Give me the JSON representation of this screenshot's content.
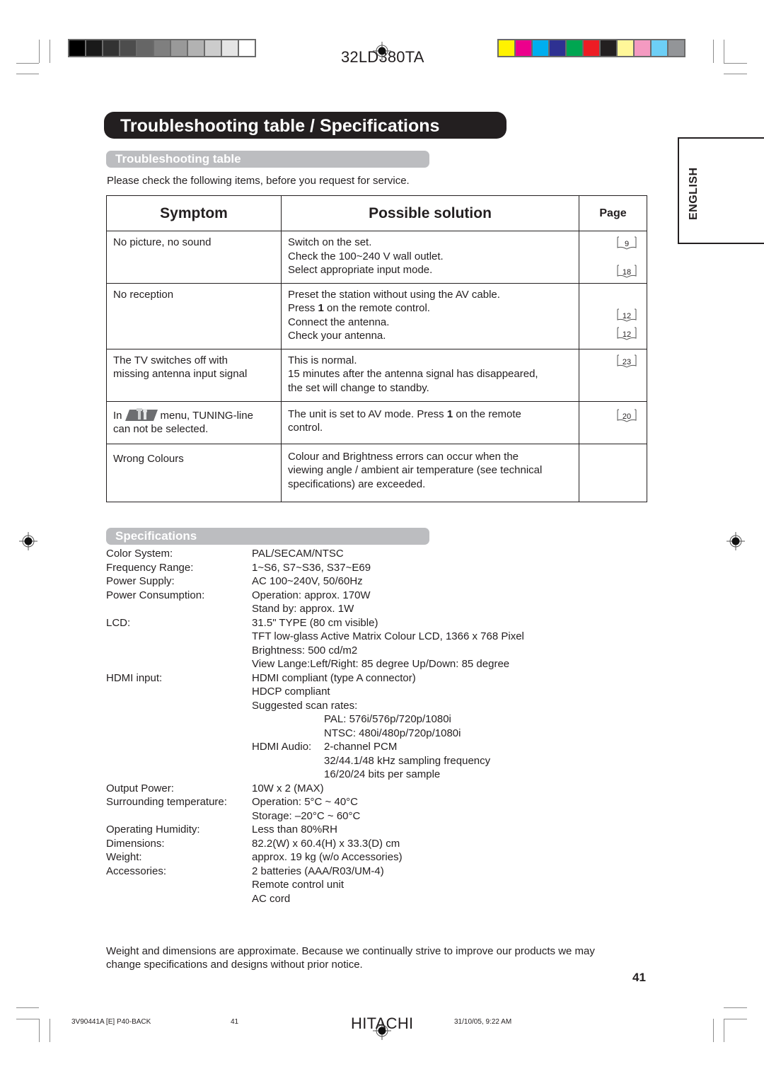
{
  "header": {
    "model": "32LD380TA",
    "grayscale_swatches": [
      "#000000",
      "#1a1a1a",
      "#333333",
      "#4d4d4d",
      "#666666",
      "#7f7f7f",
      "#999999",
      "#b2b2b2",
      "#cccccc",
      "#e5e5e5",
      "#ffffff"
    ],
    "color_swatches": [
      "#fff200",
      "#ec008c",
      "#00aeef",
      "#2e3192",
      "#00a651",
      "#ed1c24",
      "#231f20",
      "#fff799",
      "#f49ac1",
      "#6dcff6",
      "#939598"
    ]
  },
  "title": "Troubleshooting table / Specifications",
  "language_tab": "ENGLISH",
  "troubleshooting": {
    "heading": "Troubleshooting table",
    "intro": "Please check the following items, before you request for service.",
    "columns": {
      "symptom": "Symptom",
      "solution": "Possible solution",
      "page": "Page"
    },
    "rows": [
      {
        "symptom": "No picture, no sound",
        "solution": [
          "Switch on the set.",
          "Check the 100~240 V wall outlet.",
          "Select appropriate input mode."
        ],
        "pages": [
          "9",
          "18"
        ]
      },
      {
        "symptom": "No reception",
        "solution": [
          "Preset the station without using the AV cable.",
          "Press ",
          "1",
          " on the remote control.",
          "Connect the antenna.",
          "Check your antenna."
        ],
        "pages": [
          "12",
          "12"
        ]
      },
      {
        "symptom_lines": [
          "The TV switches off with",
          "missing antenna input signal"
        ],
        "solution": [
          "This is normal.",
          "15 minutes after the antenna signal has disappeared,",
          "the set will change to standby."
        ],
        "pages": [
          "23"
        ]
      },
      {
        "symptom_prefix": "In",
        "symptom_icon": "setup-menu-icon",
        "symptom_suffix": "menu, TUNING-line",
        "symptom_line2": "can not be selected.",
        "solution_a": "The unit is set to AV mode. Press ",
        "solution_bold": "1",
        "solution_b": " on the remote",
        "solution_line2": "control.",
        "pages": [
          "20"
        ]
      },
      {
        "symptom": "Wrong Colours",
        "solution": [
          "Colour and Brightness errors can occur when the",
          "viewing angle / ambient air temperature (see technical",
          "specifications) are exceeded."
        ]
      }
    ]
  },
  "specifications": {
    "heading": "Specifications",
    "items": [
      {
        "label": "Color System:",
        "values": [
          "PAL/SECAM/NTSC"
        ]
      },
      {
        "label": "Frequency Range:",
        "values": [
          "1~S6, S7~S36, S37~E69"
        ]
      },
      {
        "label": "Power Supply:",
        "values": [
          "AC 100~240V, 50/60Hz"
        ]
      },
      {
        "label": "Power Consumption:",
        "values": [
          "Operation: approx. 170W",
          "Stand by:  approx. 1W"
        ]
      },
      {
        "label": "LCD:",
        "values": [
          "31.5\" TYPE (80 cm visible)",
          "TFT low-glass Active Matrix Colour LCD, 1366 x 768 Pixel",
          "Brightness: 500 cd/m2",
          "View Lange:Left/Right: 85 degree Up/Down: 85 degree"
        ]
      },
      {
        "label": "HDMI input:",
        "values": [
          "HDMI compliant (type A connector)",
          "HDCP compliant",
          "Suggested scan rates:"
        ],
        "indented": [
          "PAL: 576i/576p/720p/1080i",
          "NTSC: 480i/480p/720p/1080i"
        ],
        "audio_label": "HDMI Audio:",
        "audio_values": [
          "2-channel PCM",
          "32/44.1/48 kHz sampling frequency",
          "16/20/24 bits per sample"
        ]
      },
      {
        "label": "Output Power:",
        "values": [
          "10W x 2 (MAX)"
        ]
      },
      {
        "label": "Surrounding temperature:",
        "values": [
          "Operation: 5°C ~ 40°C",
          "Storage: –20°C ~ 60°C"
        ]
      },
      {
        "label": "Operating Humidity:",
        "values": [
          "Less than 80%RH"
        ]
      },
      {
        "label": "Dimensions:",
        "values": [
          "82.2(W) x 60.4(H) x 33.3(D) cm"
        ]
      },
      {
        "label": "Weight:",
        "values": [
          "approx. 19 kg (w/o Accessories)"
        ]
      },
      {
        "label": "Accessories:",
        "values": [
          "2 batteries (AAA/R03/UM-4)",
          "Remote control unit",
          "AC cord"
        ]
      }
    ]
  },
  "note": "Weight and dimensions are approximate. Because we continually strive to improve our products we may change specifications and designs without prior notice.",
  "page_number": "41",
  "footer": {
    "file": "3V90441A [E] P40-BACK",
    "page": "41",
    "brand": "HITACHI",
    "timestamp": "31/10/05, 9:22 AM"
  }
}
